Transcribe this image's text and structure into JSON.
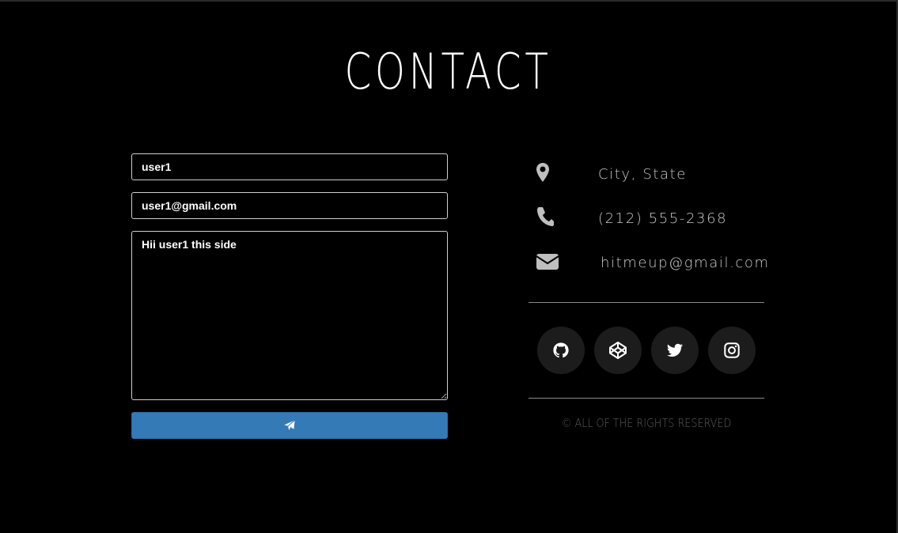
{
  "page": {
    "title": "CONTACT"
  },
  "form": {
    "name_value": "user1",
    "email_value": "user1@gmail.com",
    "message_value": "Hii user1 this side",
    "send_icon": "paper-plane-icon"
  },
  "info": [
    {
      "icon": "map-marker-icon",
      "text": "City, State"
    },
    {
      "icon": "phone-icon",
      "text": "(212) 555-2368"
    },
    {
      "icon": "envelope-icon",
      "text": "hitmeup@gmail.com"
    }
  ],
  "social": [
    {
      "icon": "github-icon"
    },
    {
      "icon": "codepen-icon"
    },
    {
      "icon": "twitter-icon"
    },
    {
      "icon": "instagram-icon"
    }
  ],
  "footer": {
    "copyright": "© ALL OF THE RIGHTS RESERVED"
  },
  "colors": {
    "background": "#000000",
    "button": "#337ab7",
    "social_bg": "#1c1c1c",
    "info_icon": "#bfbfbf"
  }
}
